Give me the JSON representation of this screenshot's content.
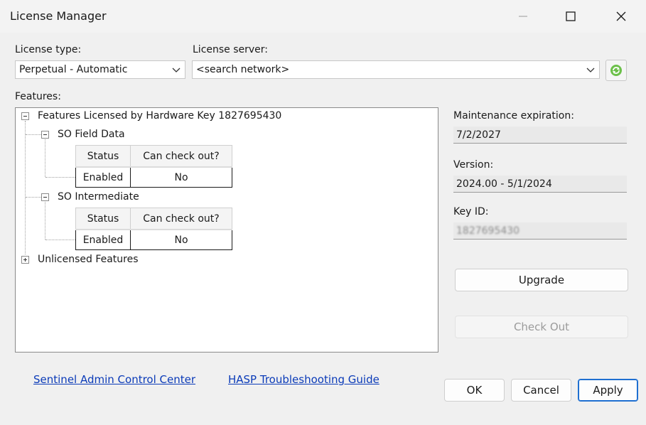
{
  "window": {
    "title": "License Manager",
    "controls": {
      "minimize": "–",
      "maximize": "☐",
      "close": "✕"
    }
  },
  "license_type": {
    "label": "License type:",
    "value": "Perpetual - Automatic"
  },
  "license_server": {
    "label": "License server:",
    "value": "<search network>"
  },
  "features": {
    "label": "Features:",
    "root": "Features Licensed by Hardware Key 1827695430",
    "groups": [
      {
        "name": "SO Field Data",
        "headers": [
          "Status",
          "Can check out?"
        ],
        "row": [
          "Enabled",
          "No"
        ]
      },
      {
        "name": "SO Intermediate",
        "headers": [
          "Status",
          "Can check out?"
        ],
        "row": [
          "Enabled",
          "No"
        ]
      }
    ],
    "unlicensed": "Unlicensed Features"
  },
  "info": {
    "maintenance_label": "Maintenance expiration:",
    "maintenance_value": "7/2/2027",
    "version_label": "Version:",
    "version_value": "2024.00 - 5/1/2024",
    "key_label": "Key ID:",
    "key_value": "1827695430"
  },
  "buttons": {
    "upgrade": "Upgrade",
    "checkout": "Check Out",
    "ok": "OK",
    "cancel": "Cancel",
    "apply": "Apply"
  },
  "links": {
    "sentinel": "Sentinel Admin Control Center",
    "hasp": "HASP Troubleshooting Guide"
  },
  "colors": {
    "accent": "#1f6fd1",
    "link": "#0b3bb8",
    "refresh_icon": "#4caf50"
  }
}
